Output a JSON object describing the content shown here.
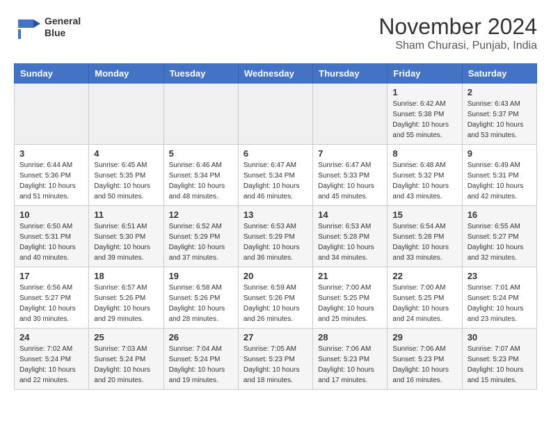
{
  "header": {
    "logo_line1": "General",
    "logo_line2": "Blue",
    "title": "November 2024",
    "subtitle": "Sham Churasi, Punjab, India"
  },
  "weekdays": [
    "Sunday",
    "Monday",
    "Tuesday",
    "Wednesday",
    "Thursday",
    "Friday",
    "Saturday"
  ],
  "weeks": [
    [
      {
        "day": "",
        "info": ""
      },
      {
        "day": "",
        "info": ""
      },
      {
        "day": "",
        "info": ""
      },
      {
        "day": "",
        "info": ""
      },
      {
        "day": "",
        "info": ""
      },
      {
        "day": "1",
        "info": "Sunrise: 6:42 AM\nSunset: 5:38 PM\nDaylight: 10 hours\nand 55 minutes."
      },
      {
        "day": "2",
        "info": "Sunrise: 6:43 AM\nSunset: 5:37 PM\nDaylight: 10 hours\nand 53 minutes."
      }
    ],
    [
      {
        "day": "3",
        "info": "Sunrise: 6:44 AM\nSunset: 5:36 PM\nDaylight: 10 hours\nand 51 minutes."
      },
      {
        "day": "4",
        "info": "Sunrise: 6:45 AM\nSunset: 5:35 PM\nDaylight: 10 hours\nand 50 minutes."
      },
      {
        "day": "5",
        "info": "Sunrise: 6:46 AM\nSunset: 5:34 PM\nDaylight: 10 hours\nand 48 minutes."
      },
      {
        "day": "6",
        "info": "Sunrise: 6:47 AM\nSunset: 5:34 PM\nDaylight: 10 hours\nand 46 minutes."
      },
      {
        "day": "7",
        "info": "Sunrise: 6:47 AM\nSunset: 5:33 PM\nDaylight: 10 hours\nand 45 minutes."
      },
      {
        "day": "8",
        "info": "Sunrise: 6:48 AM\nSunset: 5:32 PM\nDaylight: 10 hours\nand 43 minutes."
      },
      {
        "day": "9",
        "info": "Sunrise: 6:49 AM\nSunset: 5:31 PM\nDaylight: 10 hours\nand 42 minutes."
      }
    ],
    [
      {
        "day": "10",
        "info": "Sunrise: 6:50 AM\nSunset: 5:31 PM\nDaylight: 10 hours\nand 40 minutes."
      },
      {
        "day": "11",
        "info": "Sunrise: 6:51 AM\nSunset: 5:30 PM\nDaylight: 10 hours\nand 39 minutes."
      },
      {
        "day": "12",
        "info": "Sunrise: 6:52 AM\nSunset: 5:29 PM\nDaylight: 10 hours\nand 37 minutes."
      },
      {
        "day": "13",
        "info": "Sunrise: 6:53 AM\nSunset: 5:29 PM\nDaylight: 10 hours\nand 36 minutes."
      },
      {
        "day": "14",
        "info": "Sunrise: 6:53 AM\nSunset: 5:28 PM\nDaylight: 10 hours\nand 34 minutes."
      },
      {
        "day": "15",
        "info": "Sunrise: 6:54 AM\nSunset: 5:28 PM\nDaylight: 10 hours\nand 33 minutes."
      },
      {
        "day": "16",
        "info": "Sunrise: 6:55 AM\nSunset: 5:27 PM\nDaylight: 10 hours\nand 32 minutes."
      }
    ],
    [
      {
        "day": "17",
        "info": "Sunrise: 6:56 AM\nSunset: 5:27 PM\nDaylight: 10 hours\nand 30 minutes."
      },
      {
        "day": "18",
        "info": "Sunrise: 6:57 AM\nSunset: 5:26 PM\nDaylight: 10 hours\nand 29 minutes."
      },
      {
        "day": "19",
        "info": "Sunrise: 6:58 AM\nSunset: 5:26 PM\nDaylight: 10 hours\nand 28 minutes."
      },
      {
        "day": "20",
        "info": "Sunrise: 6:59 AM\nSunset: 5:26 PM\nDaylight: 10 hours\nand 26 minutes."
      },
      {
        "day": "21",
        "info": "Sunrise: 7:00 AM\nSunset: 5:25 PM\nDaylight: 10 hours\nand 25 minutes."
      },
      {
        "day": "22",
        "info": "Sunrise: 7:00 AM\nSunset: 5:25 PM\nDaylight: 10 hours\nand 24 minutes."
      },
      {
        "day": "23",
        "info": "Sunrise: 7:01 AM\nSunset: 5:24 PM\nDaylight: 10 hours\nand 23 minutes."
      }
    ],
    [
      {
        "day": "24",
        "info": "Sunrise: 7:02 AM\nSunset: 5:24 PM\nDaylight: 10 hours\nand 22 minutes."
      },
      {
        "day": "25",
        "info": "Sunrise: 7:03 AM\nSunset: 5:24 PM\nDaylight: 10 hours\nand 20 minutes."
      },
      {
        "day": "26",
        "info": "Sunrise: 7:04 AM\nSunset: 5:24 PM\nDaylight: 10 hours\nand 19 minutes."
      },
      {
        "day": "27",
        "info": "Sunrise: 7:05 AM\nSunset: 5:23 PM\nDaylight: 10 hours\nand 18 minutes."
      },
      {
        "day": "28",
        "info": "Sunrise: 7:06 AM\nSunset: 5:23 PM\nDaylight: 10 hours\nand 17 minutes."
      },
      {
        "day": "29",
        "info": "Sunrise: 7:06 AM\nSunset: 5:23 PM\nDaylight: 10 hours\nand 16 minutes."
      },
      {
        "day": "30",
        "info": "Sunrise: 7:07 AM\nSunset: 5:23 PM\nDaylight: 10 hours\nand 15 minutes."
      }
    ]
  ]
}
